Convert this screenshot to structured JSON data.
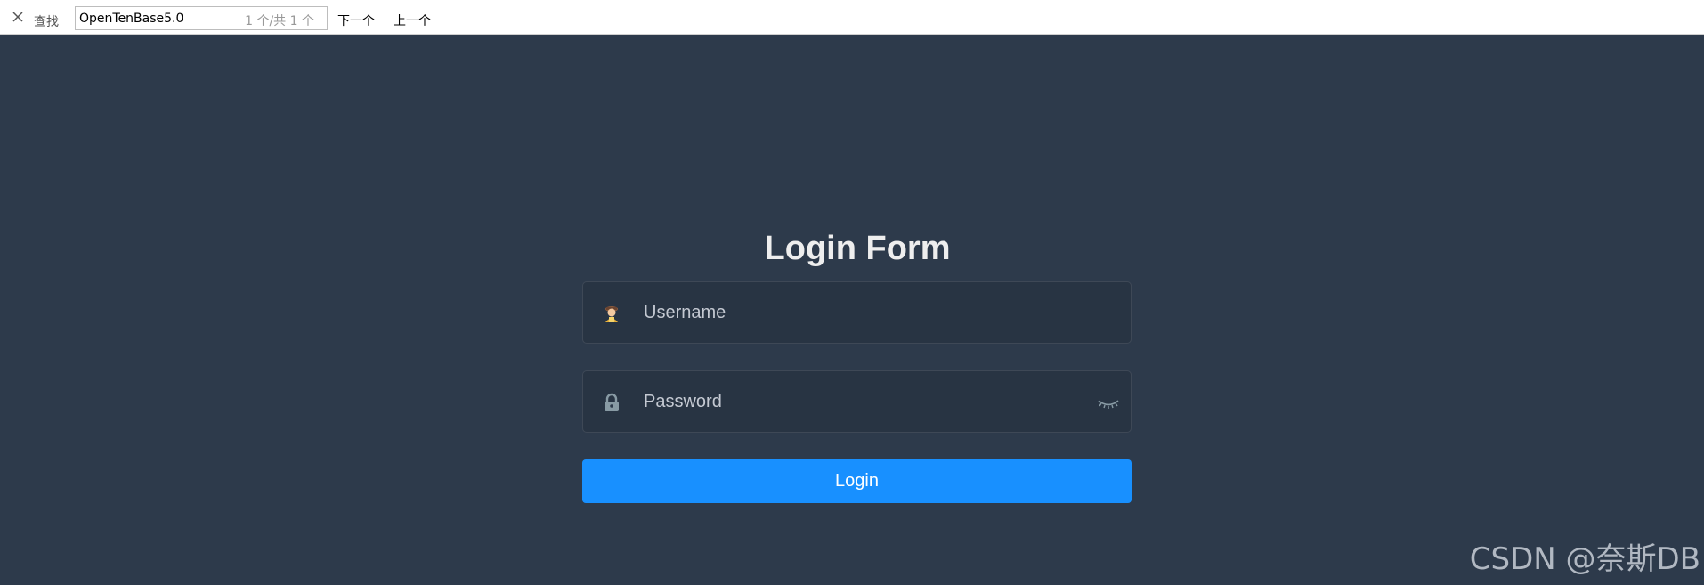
{
  "find_bar": {
    "label": "查找",
    "query": "OpenTenBase5.0",
    "match_count": "1 个/共 1 个",
    "next_label": "下一个",
    "prev_label": "上一个"
  },
  "login": {
    "title": "Login Form",
    "username_placeholder": "Username",
    "password_placeholder": "Password",
    "button_label": "Login"
  },
  "watermark": "CSDN @奈斯DB",
  "colors": {
    "background": "#2d3a4b",
    "accent": "#1890ff"
  },
  "icons": {
    "close": "close-icon",
    "user": "user-icon",
    "lock": "lock-icon",
    "eye": "eye-closed-icon"
  }
}
